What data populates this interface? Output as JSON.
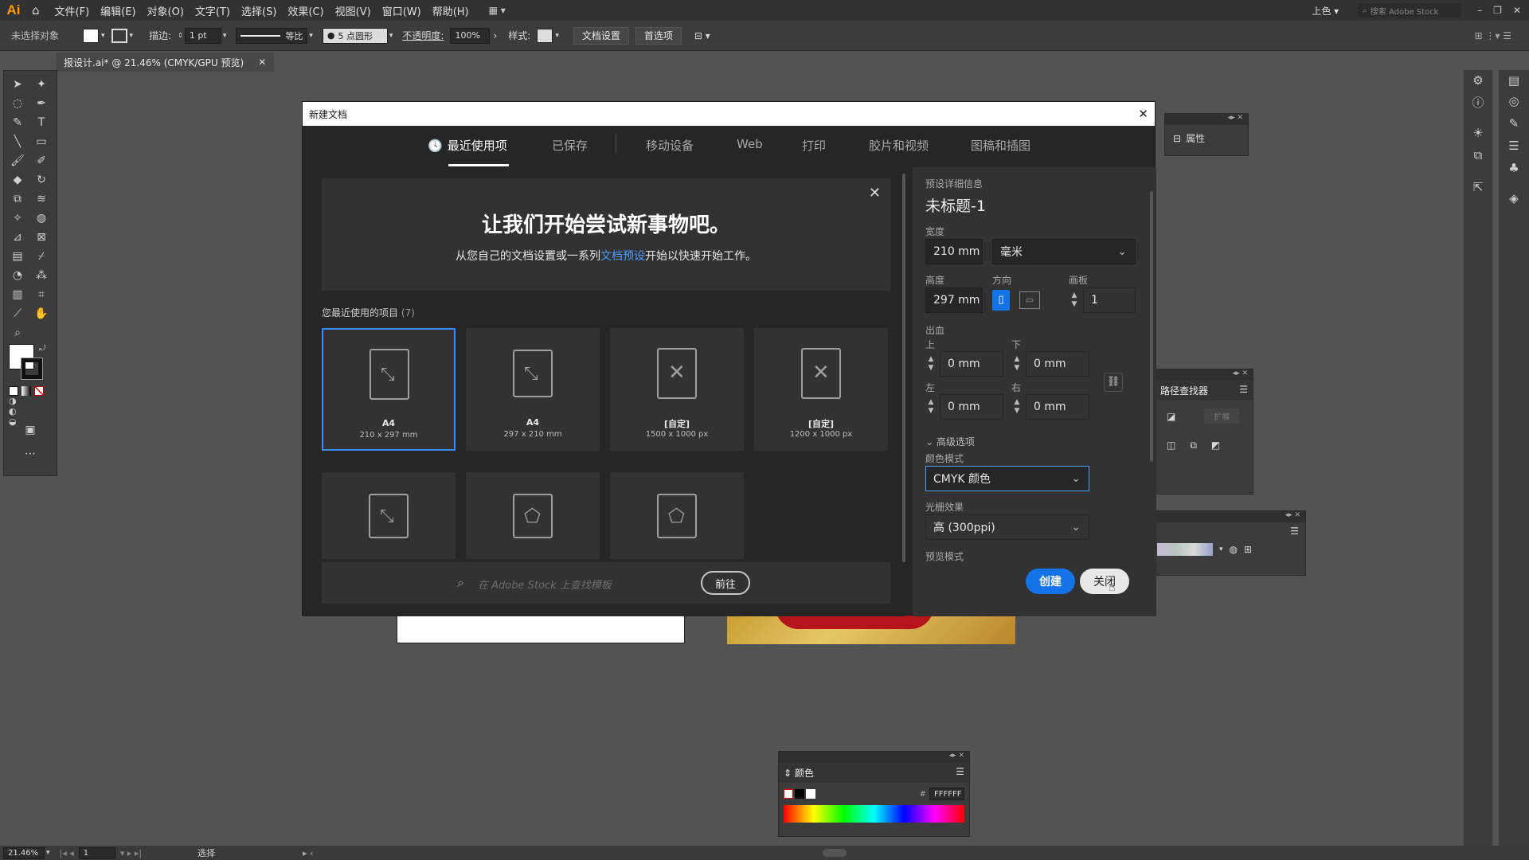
{
  "app": {
    "logo": "Ai"
  },
  "menubar": {
    "items": [
      "文件(F)",
      "编辑(E)",
      "对象(O)",
      "文字(T)",
      "选择(S)",
      "效果(C)",
      "视图(V)",
      "窗口(W)",
      "帮助(H)"
    ],
    "workspace": "上色",
    "search_placeholder": "搜索 Adobe Stock"
  },
  "control_bar": {
    "no_selection": "未选择对象",
    "stroke_label": "描边:",
    "stroke_value": "1 pt",
    "profile_label": "等比",
    "brush_label": "5 点圆形",
    "opacity_label": "不透明度:",
    "opacity_value": "100%",
    "style_label": "样式:",
    "doc_setup": "文档设置",
    "preferences": "首选项"
  },
  "document_tab": {
    "title": "报设计.ai* @ 21.46% (CMYK/GPU 预览)"
  },
  "dialog": {
    "title": "新建文档",
    "tabs": [
      "最近使用项",
      "已保存",
      "移动设备",
      "Web",
      "打印",
      "胶片和视频",
      "图稿和插图"
    ],
    "active_tab": "最近使用项",
    "banner": {
      "headline": "让我们开始尝试新事物吧。",
      "sub_before": "从您自己的文档设置或一系列",
      "sub_link": "文档预设",
      "sub_after": "开始以快速开始工作。"
    },
    "recent_label": "您最近使用的项目",
    "recent_count": "(7)",
    "cards": [
      {
        "name": "A4",
        "size": "210 x 297 mm",
        "selected": true
      },
      {
        "name": "A4",
        "size": "297 x 210 mm"
      },
      {
        "name": "[自定]",
        "size": "1500 x 1000 px"
      },
      {
        "name": "[自定]",
        "size": "1200 x 1000 px"
      },
      {
        "name": "",
        "size": ""
      },
      {
        "name": "",
        "size": ""
      },
      {
        "name": "",
        "size": ""
      }
    ],
    "search_placeholder": "在 Adobe Stock 上查找模板",
    "go_button": "前往",
    "details": {
      "section": "预设详细信息",
      "doc_name": "未标题-1",
      "width_label": "宽度",
      "width_value": "210 mm",
      "unit": "毫米",
      "height_label": "高度",
      "height_value": "297 mm",
      "orientation_label": "方向",
      "artboards_label": "画板",
      "artboards_value": "1",
      "bleed_label": "出血",
      "top_label": "上",
      "bottom_label": "下",
      "left_label": "左",
      "right_label": "右",
      "bleed_top": "0 mm",
      "bleed_bottom": "0 mm",
      "bleed_left": "0 mm",
      "bleed_right": "0 mm",
      "advanced": "高级选项",
      "color_mode_label": "颜色模式",
      "color_mode": "CMYK 颜色",
      "raster_label": "光栅效果",
      "raster_value": "高 (300ppi)",
      "preview_label": "预览模式",
      "create_button": "创建",
      "close_button": "关闭"
    }
  },
  "panels": {
    "properties": "属性",
    "pathfinder": "路径查找器",
    "expand": "扩展",
    "color_title": "颜色",
    "hex_value": "FFFFFF"
  },
  "status": {
    "zoom": "21.46%",
    "artboard": "1",
    "tool": "选择"
  },
  "colors": {
    "accent": "#1473e6",
    "selection": "#3a86ff",
    "link": "#4b9cff"
  }
}
